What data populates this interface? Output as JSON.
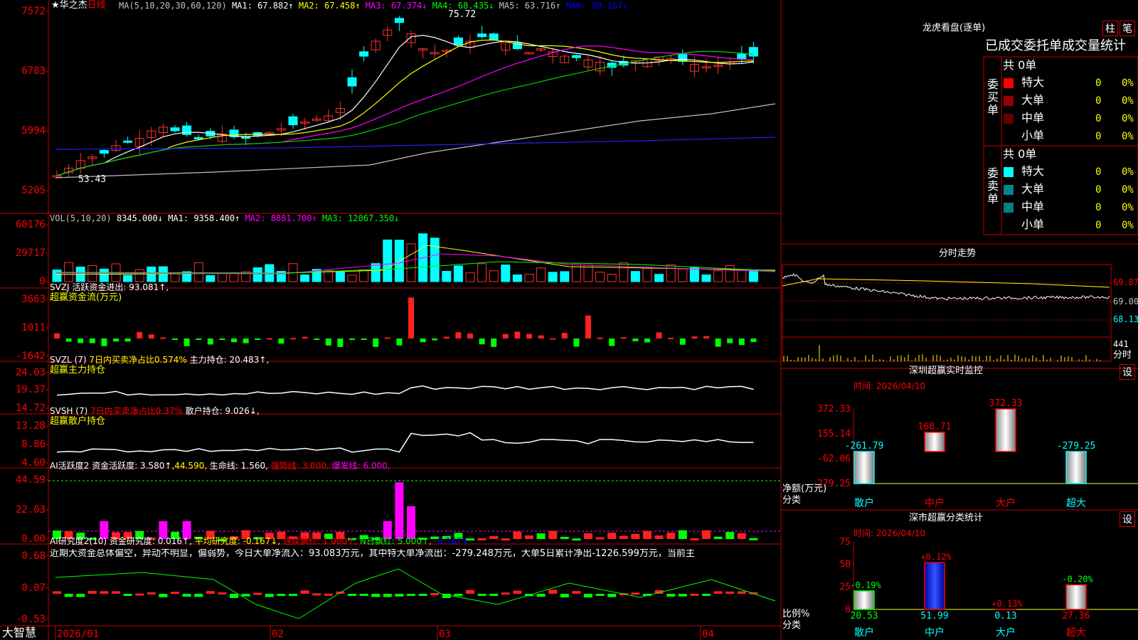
{
  "main": {
    "title": "华之杰",
    "period": "日线",
    "ma_text": "MA(5,10,20,30,60,120)",
    "ma_values": [
      {
        "label": "MA1: 67.882↑",
        "color": "#ffffff"
      },
      {
        "label": "MA2: 67.458↑",
        "color": "#ffff00"
      },
      {
        "label": "MA3: 67.374↓",
        "color": "#ff00ff"
      },
      {
        "label": "MA4: 68.435↓",
        "color": "#00ff00"
      },
      {
        "label": "MA5: 63.716↑",
        "color": "#c0c0c0"
      },
      {
        "label": "MA6: 59.167↑",
        "color": "#0000ff"
      }
    ],
    "y_ticks": [
      "7572",
      "6783",
      "5994",
      "5205"
    ],
    "high_label": "75.72",
    "low_label": "53.43"
  },
  "vol": {
    "header": "VOL(5,10,20)",
    "value": "8345.000↓",
    "ma": [
      {
        "label": "MA1: 9358.400↑",
        "color": "#ffffff"
      },
      {
        "label": "MA2: 8881.700↑",
        "color": "#ff00ff"
      },
      {
        "label": "MA3: 12067.350↓",
        "color": "#00ff00"
      }
    ],
    "y_ticks": [
      "60176",
      "29717",
      "0"
    ]
  },
  "svzj": {
    "header": "SVZJ 活跃资金进出: 93.081↑,",
    "sub": "超赢资金流(万元)",
    "y_ticks": [
      "3663",
      "1011",
      "-1642"
    ]
  },
  "svzl": {
    "header_a": "SVZL (7) ",
    "header_b": "7日内买卖净占比0.574%",
    "header_c": " 主力持仓: 20.483↑,",
    "sub": "超赢主力持仓",
    "y_ticks": [
      "24.03",
      "19.37",
      "14.72"
    ]
  },
  "svsh": {
    "header_a": "SVSH (7) ",
    "header_b": "7日内买卖净占比0.37%",
    "header_c": " 散户持仓: 9.026↓,",
    "sub": "超赢散户持仓",
    "y_ticks": [
      "13.28",
      "8.86",
      "4.60"
    ]
  },
  "ai1": {
    "header_a": "AI活跃度2 资金活跃度: 3.580↑,",
    "header_b": "44.590,",
    "header_c": " 生命线: 1.560,",
    "header_d": " 强势线: 3.000,",
    "header_e": " 爆发线: 6.000,",
    "y_ticks": [
      "44.59",
      "22.03",
      "0.00"
    ]
  },
  "ai2": {
    "header_a": "AI研究度2(10) 资金研究度: 0.016↑,",
    "header_b": " 平均研究度: -0.167↓,",
    "header_c": " 连续飘红: 1.000↑,",
    "header_d": " N日飘红: 5.000↑,",
    "header_e": " -0.167↓",
    "commentary": "近期大资金总体偏空，异动不明显，偏弱势，今日大单净流入：93.083万元，其中特大单净流出：-279.248万元，大单5日累计净出-1226.599万元，当前主",
    "y_ticks": [
      "0.68",
      "0.07",
      "-0.53"
    ]
  },
  "x_axis": {
    "labels": [
      "2026/01",
      "02",
      "03",
      "04"
    ]
  },
  "brand": "大智慧",
  "dragon": {
    "title": "龙虎看盘(逐单)",
    "btn_bar": "柱",
    "btn_pen": "笔",
    "header": "已成交委托单成交量统计",
    "buy_label": "委买单",
    "sell_label": "委卖单",
    "buy_total": "共 0单",
    "sell_total": "共 0单",
    "buy_rows": [
      {
        "name": "特大",
        "n": "0",
        "pct": "0%",
        "color": "#ff0000"
      },
      {
        "name": "大单",
        "n": "0",
        "pct": "0%",
        "color": "#990000"
      },
      {
        "name": "中单",
        "n": "0",
        "pct": "0%",
        "color": "#660000"
      },
      {
        "name": "小单",
        "n": "0",
        "pct": "0%",
        "color": ""
      }
    ],
    "sell_rows": [
      {
        "name": "特大",
        "n": "0",
        "pct": "0%",
        "color": "#00ffff"
      },
      {
        "name": "大单",
        "n": "0",
        "pct": "0%",
        "color": "#008888"
      },
      {
        "name": "中单",
        "n": "0",
        "pct": "0%",
        "color": "#008080"
      },
      {
        "name": "小单",
        "n": "0",
        "pct": "0%",
        "color": ""
      }
    ]
  },
  "intraday": {
    "title": "分时走势",
    "prices": [
      "69.87",
      "69.00",
      "68.13"
    ],
    "volume": "441",
    "label": "分时"
  },
  "monitor": {
    "title": "深圳超赢实时监控",
    "btn": "设",
    "date": "时间: 2026/04/10",
    "y_ticks": [
      "372.33",
      "155.14",
      "-62.06",
      "-279.25"
    ],
    "y_label": "净额(万元)",
    "x_label": "分类",
    "categories": [
      "散户",
      "中户",
      "大户",
      "超大"
    ],
    "values": [
      -261.79,
      168.71,
      372.33,
      -279.25
    ],
    "value_labels": [
      "-261.79",
      "168.71",
      "372.33",
      "-279.25"
    ]
  },
  "classify": {
    "title": "深市超赢分类统计",
    "btn": "设",
    "date": "时间: 2026/04/10",
    "y_ticks": [
      "75",
      "50",
      "25",
      "0"
    ],
    "y_label": "比例%",
    "x_label": "分类",
    "categories": [
      "散户",
      "中户",
      "大户",
      "超大"
    ],
    "values": [
      20.53,
      51.99,
      0.13,
      27.36
    ],
    "value_labels": [
      "20.53",
      "51.99",
      "0.13",
      "27.36"
    ],
    "changes": [
      "-0.19%",
      "+0.12%",
      "+0.13%",
      "-0.20%"
    ]
  },
  "chart_data": {
    "type": "bar",
    "title": "深圳超赢实时监控",
    "categories": [
      "散户",
      "中户",
      "大户",
      "超大"
    ],
    "series": [
      {
        "name": "净额(万元)",
        "values": [
          -261.79,
          168.71,
          372.33,
          -279.25
        ]
      },
      {
        "name": "比例%",
        "values": [
          20.53,
          51.99,
          0.13,
          27.36
        ]
      }
    ]
  }
}
